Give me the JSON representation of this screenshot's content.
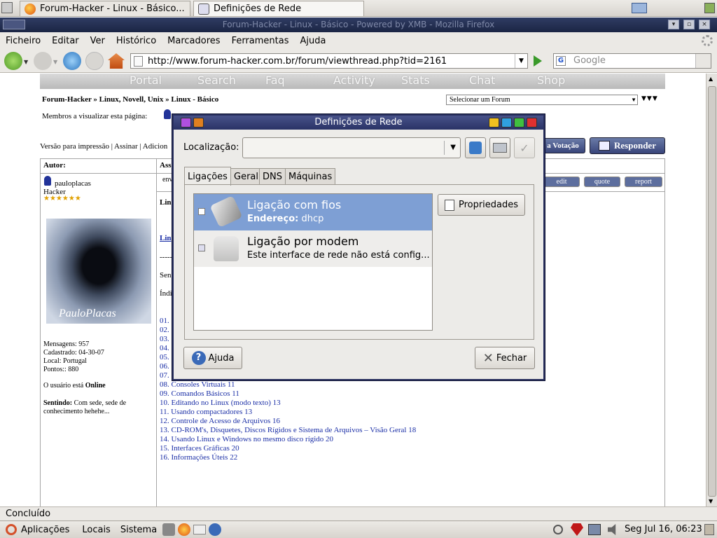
{
  "panel_tabs": [
    {
      "label": "Forum-Hacker - Linux - Básico..."
    },
    {
      "label": "Definições de Rede"
    }
  ],
  "browser": {
    "title": "Forum-Hacker - Linux - Básico - Powered by XMB - Mozilla Firefox",
    "menu": [
      "Ficheiro",
      "Editar",
      "Ver",
      "Histórico",
      "Marcadores",
      "Ferramentas",
      "Ajuda"
    ],
    "url": "http://www.forum-hacker.com.br/forum/viewthread.php?tid=2161",
    "search_placeholder": "Google",
    "status": "Concluído"
  },
  "forum": {
    "nav": [
      "Portal",
      "Search",
      "Faq",
      "Activity",
      "Stats",
      "Chat",
      "Shop"
    ],
    "breadcrumb": "Forum-Hacker » Linux, Novell, Unix » Linux - Básico",
    "forum_select": "Selecionar um Forum",
    "members_viewing": "Membros a visualizar esta página:",
    "actions": "Versão para impressão | Assinar | Adicion",
    "btn_votacao": "a Votação",
    "btn_responder": "Responder",
    "col_author": "Autor:",
    "col_subject": "Ass",
    "sent": "env",
    "post_buttons": [
      "edit",
      "quote",
      "report"
    ],
    "user": {
      "name": "pauloplacas",
      "rank": "Hacker",
      "stars": "★★★★★★",
      "avatar_text": "PauloPlacas",
      "stats": [
        "Mensagens: 957",
        "Cadastrado: 04-30-07",
        "Local: Portugal",
        "Pontos:: 880"
      ],
      "online_prefix": "O usuário está ",
      "online_status": "Online",
      "feeling_label": "Sentindo:",
      "feeling_text": "Com sede, sede de conhecimento hehehe..."
    },
    "post_fragments": [
      "Lin",
      "Lin",
      "-----",
      "Sen",
      "Índi"
    ],
    "index_fragments": [
      "01.",
      "02.",
      "03.",
      "04.",
      "05.",
      "06.",
      "07."
    ],
    "index": [
      "08. Consoles Virtuais 11",
      "09. Comandos Básicos 11",
      "10. Editando no Linux (modo texto) 13",
      "11. Usando compactadores 13",
      "12. Controle de Acesso de Arquivos 16",
      "13. CD-ROM's, Disquetes, Discos Rígidos e Sistema de Arquivos – Visão Geral 18",
      "14. Usando Linux e Windows no mesmo disco rígido 20",
      "15. Interfaces Gráficas 20",
      "16. Informações Úteis 22"
    ]
  },
  "dialog": {
    "title": "Definições de Rede",
    "location_label": "Localização:",
    "tabs": [
      "Ligações",
      "Geral",
      "DNS",
      "Máquinas"
    ],
    "connections": [
      {
        "title": "Ligação com fios",
        "label": "Endereço:",
        "value": "dhcp"
      },
      {
        "title": "Ligação por modem",
        "subtitle": "Este interface de rede não está config..."
      }
    ],
    "properties_button": "Propriedades",
    "help_button": "Ajuda",
    "close_button": "Fechar"
  },
  "bottom_panel": {
    "menus": [
      "Aplicações",
      "Locais",
      "Sistema"
    ],
    "clock": "Seg Jul 16, 06:23"
  }
}
